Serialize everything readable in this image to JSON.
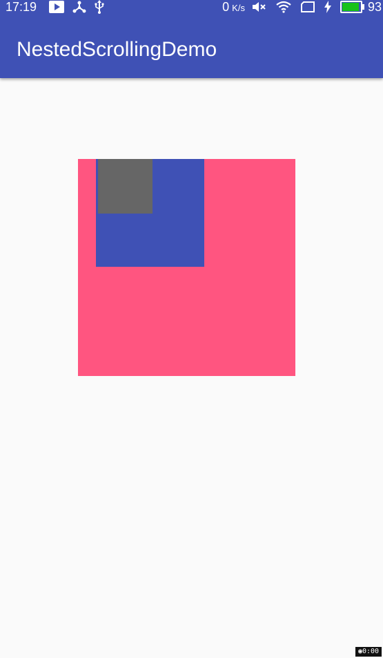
{
  "status_bar": {
    "time": "17:19",
    "notification_icons": [
      "play-store-icon",
      "network-share-icon",
      "usb-icon"
    ],
    "net_speed_value": "0",
    "net_speed_unit": "K/s",
    "status_icons": [
      "mute-icon",
      "wifi-icon",
      "sim-card-icon",
      "charging-bolt-icon"
    ],
    "battery_percent": "93",
    "battery_level": 0.93,
    "battery_color": "#18c21a"
  },
  "app_bar": {
    "title": "NestedScrollingDemo",
    "color": "#3f51b5"
  },
  "views": {
    "parent_color": "#ff5580",
    "child_color": "#3f51b5",
    "grandchild_color": "#666666"
  },
  "overlay": {
    "badge_label": "0:00",
    "badge_icon": "record-dot-icon"
  }
}
